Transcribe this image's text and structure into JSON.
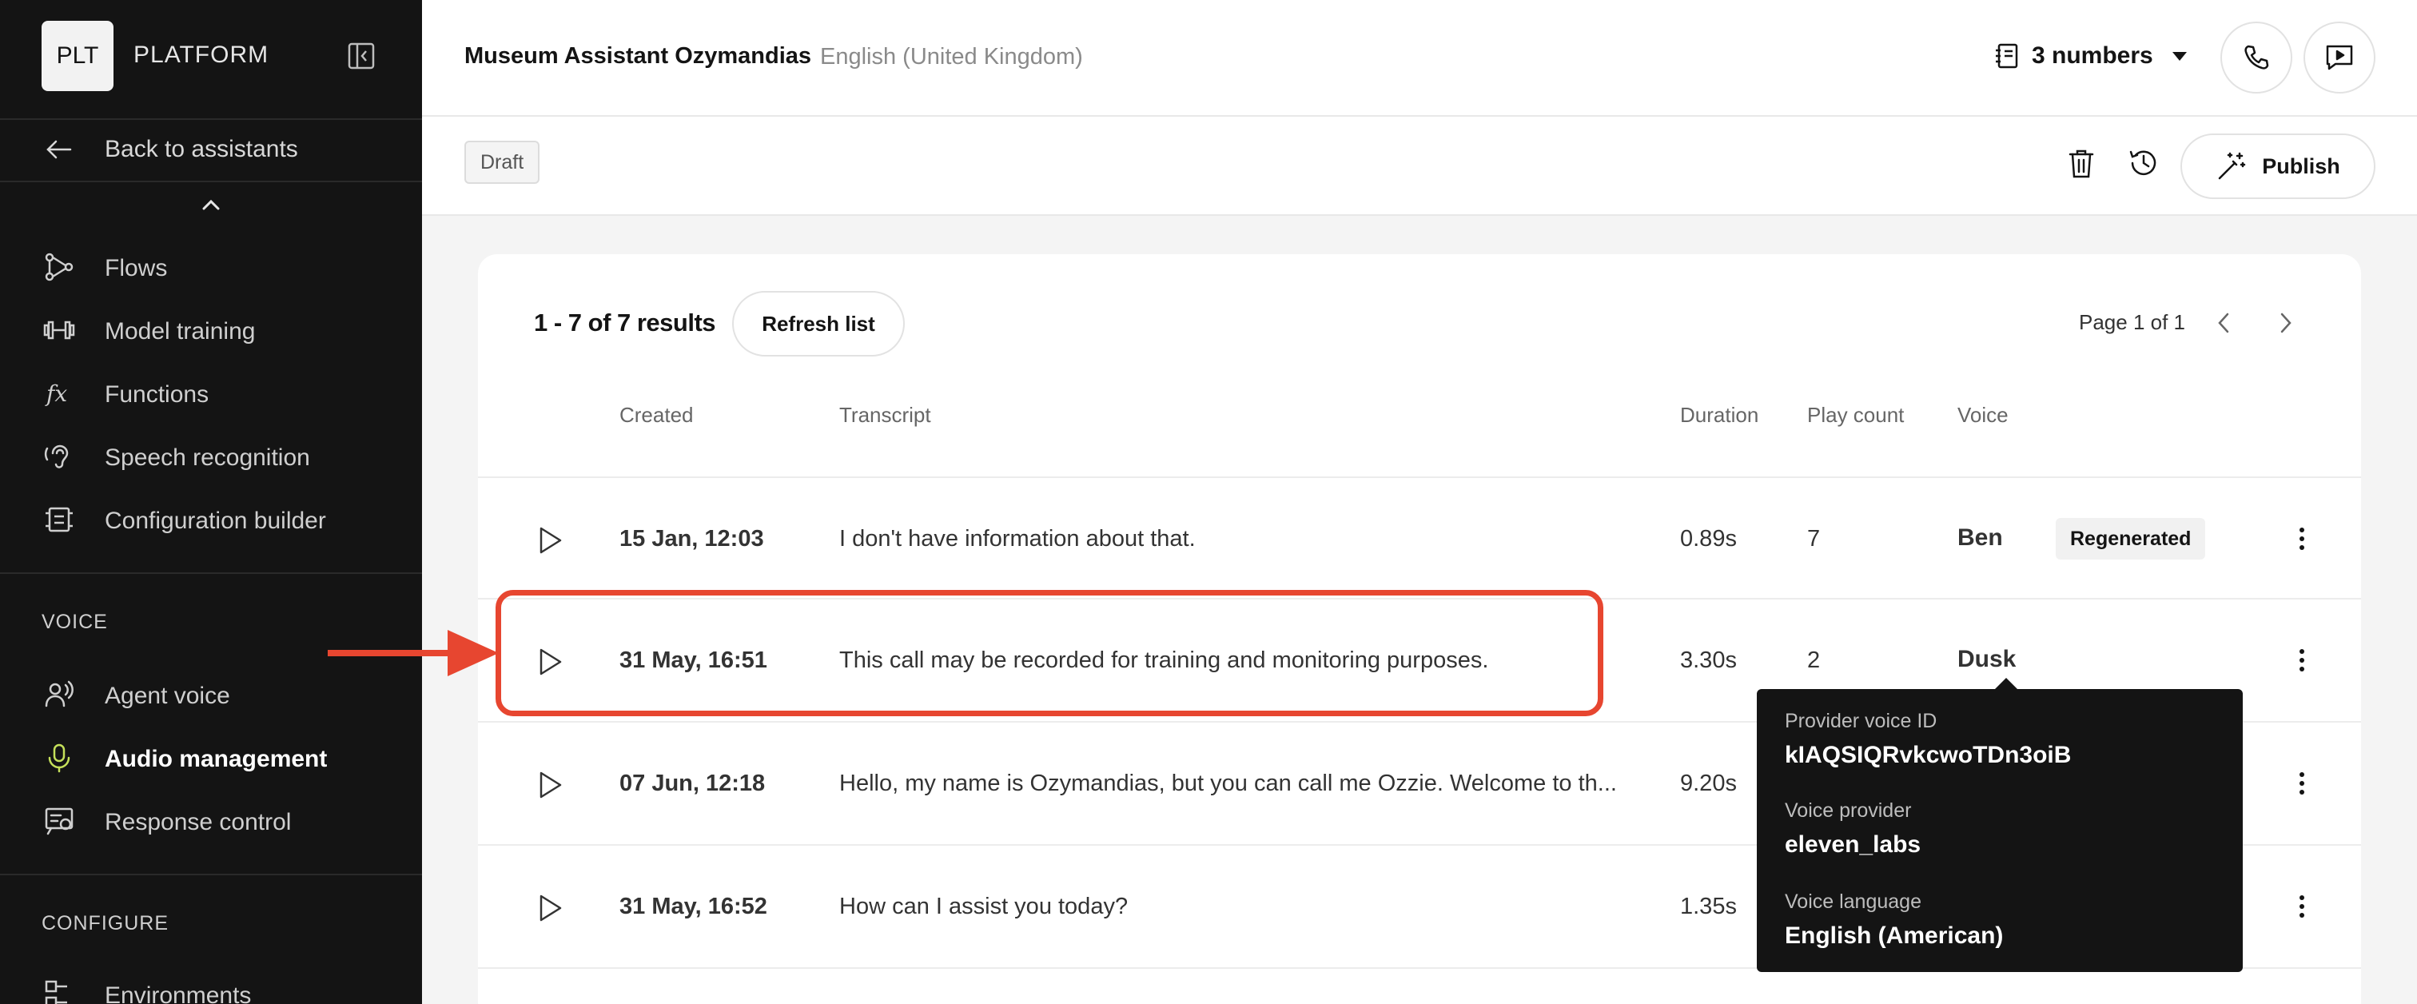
{
  "sidebar": {
    "brand_logo": "PLT",
    "brand_name": "PLATFORM",
    "back_label": "Back to assistants",
    "build_items": [
      {
        "label": "Flows",
        "icon": "flows-icon"
      },
      {
        "label": "Model training",
        "icon": "dumbbell-icon"
      },
      {
        "label": "Functions",
        "icon": "function-icon"
      },
      {
        "label": "Speech recognition",
        "icon": "ear-icon"
      },
      {
        "label": "Configuration builder",
        "icon": "config-icon"
      }
    ],
    "voice_heading": "VOICE",
    "voice_items": [
      {
        "label": "Agent voice",
        "icon": "agent-voice-icon"
      },
      {
        "label": "Audio management",
        "icon": "microphone-icon",
        "active": true
      },
      {
        "label": "Response control",
        "icon": "response-control-icon"
      }
    ],
    "configure_heading": "CONFIGURE",
    "configure_items": [
      {
        "label": "Environments",
        "icon": "environments-icon"
      }
    ]
  },
  "header": {
    "title": "Museum Assistant Ozymandias",
    "locale": "English (United Kingdom)",
    "numbers_label": "3 numbers"
  },
  "subheader": {
    "status_badge": "Draft",
    "publish_label": "Publish"
  },
  "table": {
    "results_label": "1 - 7 of 7 results",
    "refresh_label": "Refresh list",
    "page_label": "Page 1 of 1",
    "columns": {
      "created": "Created",
      "transcript": "Transcript",
      "duration": "Duration",
      "play_count": "Play count",
      "voice": "Voice"
    },
    "rows": [
      {
        "created": "15 Jan, 12:03",
        "transcript": "I don't have information about that.",
        "duration": "0.89s",
        "play_count": "7",
        "voice": "Ben",
        "tag": "Regenerated"
      },
      {
        "created": "31 May, 16:51",
        "transcript": "This call may be recorded for training and monitoring purposes.",
        "duration": "3.30s",
        "play_count": "2",
        "voice": "Dusk",
        "tag": ""
      },
      {
        "created": "07 Jun, 12:18",
        "transcript": "Hello, my name is Ozymandias, but you can call me Ozzie. Welcome to th...",
        "duration": "9.20s",
        "play_count": "",
        "voice": "",
        "tag": ""
      },
      {
        "created": "31 May, 16:52",
        "transcript": "How can I assist you today?",
        "duration": "1.35s",
        "play_count": "",
        "voice": "",
        "tag": ""
      }
    ]
  },
  "tooltip": {
    "provider_voice_id_label": "Provider voice ID",
    "provider_voice_id": "kIAQSIQRvkcwoTDn3oiB",
    "voice_provider_label": "Voice provider",
    "voice_provider": "eleven_labs",
    "voice_language_label": "Voice language",
    "voice_language": "English (American)"
  },
  "colors": {
    "sidebar_bg": "#141414",
    "active_icon": "#c5e05a",
    "annotation": "#e74630"
  }
}
